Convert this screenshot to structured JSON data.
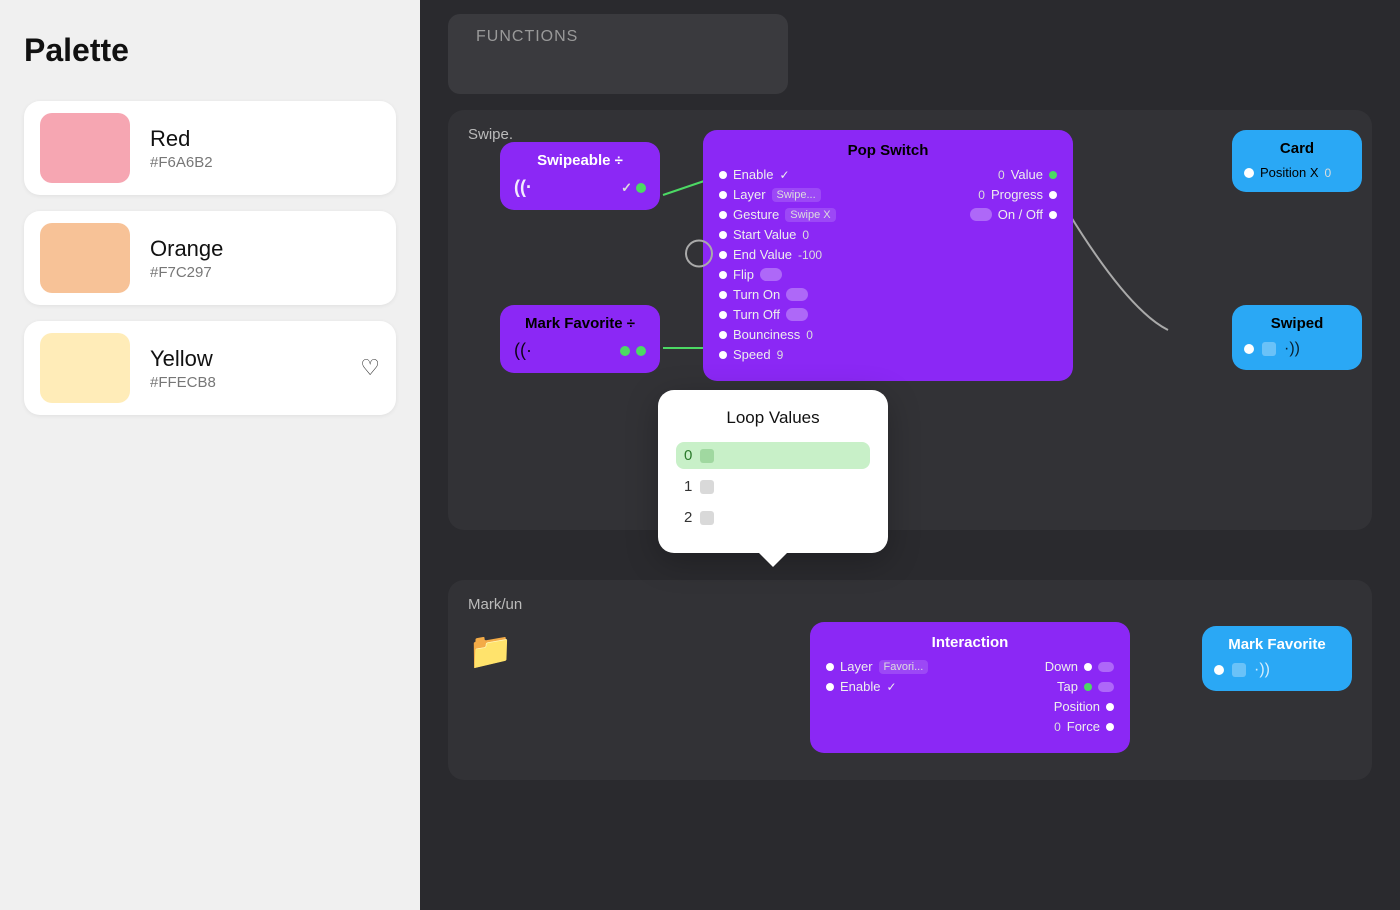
{
  "left_panel": {
    "title": "Palette",
    "colors": [
      {
        "id": "red",
        "name": "Red",
        "hex": "#F6A6B2",
        "display_hex": "#F6A6B2"
      },
      {
        "id": "orange",
        "name": "Orange",
        "hex": "#F7C297",
        "display_hex": "#F7C297"
      },
      {
        "id": "yellow",
        "name": "Yellow",
        "hex": "#FFECB8",
        "display_hex": "#FFECB8",
        "has_heart": true
      }
    ]
  },
  "right_panel": {
    "functions_label": "FUNCTIONS",
    "swipe_section_label": "Swipe.",
    "markun_section_label": "Mark/un",
    "nodes": {
      "swipeable": {
        "title": "Swipeable ÷",
        "wave": "((·",
        "checkmark": "✓"
      },
      "pop_switch": {
        "title": "Pop Switch",
        "fields_left": [
          {
            "label": "Enable",
            "value": "✓",
            "type": "check"
          },
          {
            "label": "Layer",
            "value": "Swipe...",
            "type": "tag"
          },
          {
            "label": "Gesture",
            "value": "Swipe X",
            "type": "tag"
          },
          {
            "label": "Start Value",
            "value": "0",
            "type": "val"
          },
          {
            "label": "End Value",
            "value": "-100",
            "type": "val"
          },
          {
            "label": "Flip",
            "value": "",
            "type": "toggle"
          },
          {
            "label": "Turn On",
            "value": "",
            "type": "toggle"
          },
          {
            "label": "Turn Off",
            "value": "",
            "type": "toggle"
          },
          {
            "label": "Bounciness",
            "value": "0",
            "type": "val"
          },
          {
            "label": "Speed",
            "value": "9",
            "type": "val"
          }
        ],
        "fields_right": [
          {
            "label": "Value",
            "value": "0",
            "type": "val"
          },
          {
            "label": "Progress",
            "value": "0",
            "type": "val"
          },
          {
            "label": "On / Off",
            "value": "",
            "type": "toggle"
          }
        ]
      },
      "card": {
        "title": "Card",
        "field_label": "Position X",
        "field_value": "0"
      },
      "swiped": {
        "title": "Swiped"
      },
      "mark_favorite_swipe": {
        "title": "Mark Favorite ÷",
        "wave": "((·"
      },
      "loop_values": {
        "title": "Loop Values",
        "items": [
          {
            "label": "0",
            "active": true
          },
          {
            "label": "1",
            "active": false
          },
          {
            "label": "2",
            "active": false
          }
        ]
      },
      "interaction": {
        "title": "Interaction",
        "fields_left": [
          {
            "label": "Layer",
            "value": "Favori...",
            "type": "tag"
          },
          {
            "label": "Enable",
            "value": "✓",
            "type": "check"
          }
        ],
        "fields_right": [
          {
            "label": "Down",
            "value": "",
            "type": "toggle"
          },
          {
            "label": "Tap",
            "value": "",
            "type": "dot-green"
          },
          {
            "label": "Position",
            "value": "",
            "type": "dot"
          },
          {
            "label": "Force",
            "value": "0",
            "type": "dot"
          }
        ]
      },
      "mark_favorite_int": {
        "title": "Mark Favorite"
      }
    }
  }
}
